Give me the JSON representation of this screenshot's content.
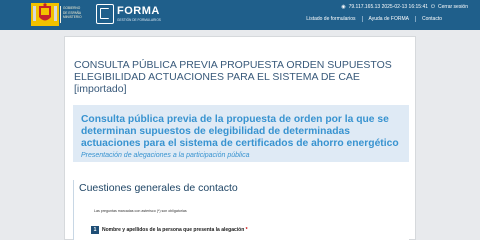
{
  "header": {
    "gov": {
      "line1": "GOBIERNO",
      "line2": "DE ESPAÑA",
      "line3": "MINISTERIO"
    },
    "logo": {
      "title": "FORMA",
      "subtitle": "GESTIÓN DE FORMULARIOS"
    },
    "session_info": "79.117.165.13 2025-02-13 16:15:41",
    "logout": "Cerrar sesión",
    "nav": [
      "Listado de formularios",
      "Ayuda de FORMA",
      "Contacto"
    ]
  },
  "form": {
    "heading": "CONSULTA PÚBLICA PREVIA PROPUESTA ORDEN SUPUESTOS ELEGIBILIDAD ACTUACIONES PARA EL SISTEMA DE CAE [importado]",
    "note_title": "Consulta pública previa de la propuesta de orden por la que se determinan supuestos de elegibilidad de determinadas actuaciones para el sistema de certificados de ahorro energético",
    "note_subtitle": "Presentación de alegaciones a la participación pública",
    "section_title": "Cuestiones generales de contacto",
    "required_note": "Las preguntas marcadas con asterisco (*) son obligatorias",
    "question": {
      "number": "1",
      "label": "Nombre y apellidos de la persona que presenta la alegación",
      "star": "*"
    }
  },
  "colors": {
    "header_bg": "#1f5f8b",
    "accent": "#3893d0",
    "page_bg": "#e8eaed"
  }
}
